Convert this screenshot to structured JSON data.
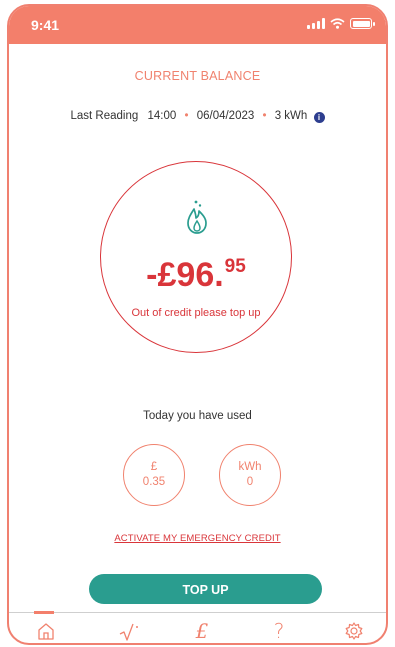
{
  "status_bar": {
    "time": "9:41"
  },
  "balance": {
    "title": "CURRENT BALANCE",
    "last_reading_label": "Last Reading",
    "reading_time": "14:00",
    "reading_date": "06/04/2023",
    "reading_kwh": "3 kWh",
    "amount_main": "-£96.",
    "amount_pence": "95",
    "message": "Out of credit please top up"
  },
  "usage": {
    "label": "Today you have used",
    "money": {
      "unit": "£",
      "value": "0.35"
    },
    "energy": {
      "unit": "kWh",
      "value": "0"
    }
  },
  "emergency_link": "ACTIVATE MY EMERGENCY CREDIT",
  "topup_label": "TOP UP",
  "colors": {
    "accent": "#f37f6b",
    "alert": "#d9353a",
    "primary_button": "#2a9d8f",
    "info": "#2d3e8f"
  },
  "nav": {
    "icons": [
      "home-icon",
      "usage-icon",
      "pound-icon",
      "help-icon",
      "settings-icon"
    ],
    "pound_glyph": "£",
    "help_glyph": "?"
  }
}
